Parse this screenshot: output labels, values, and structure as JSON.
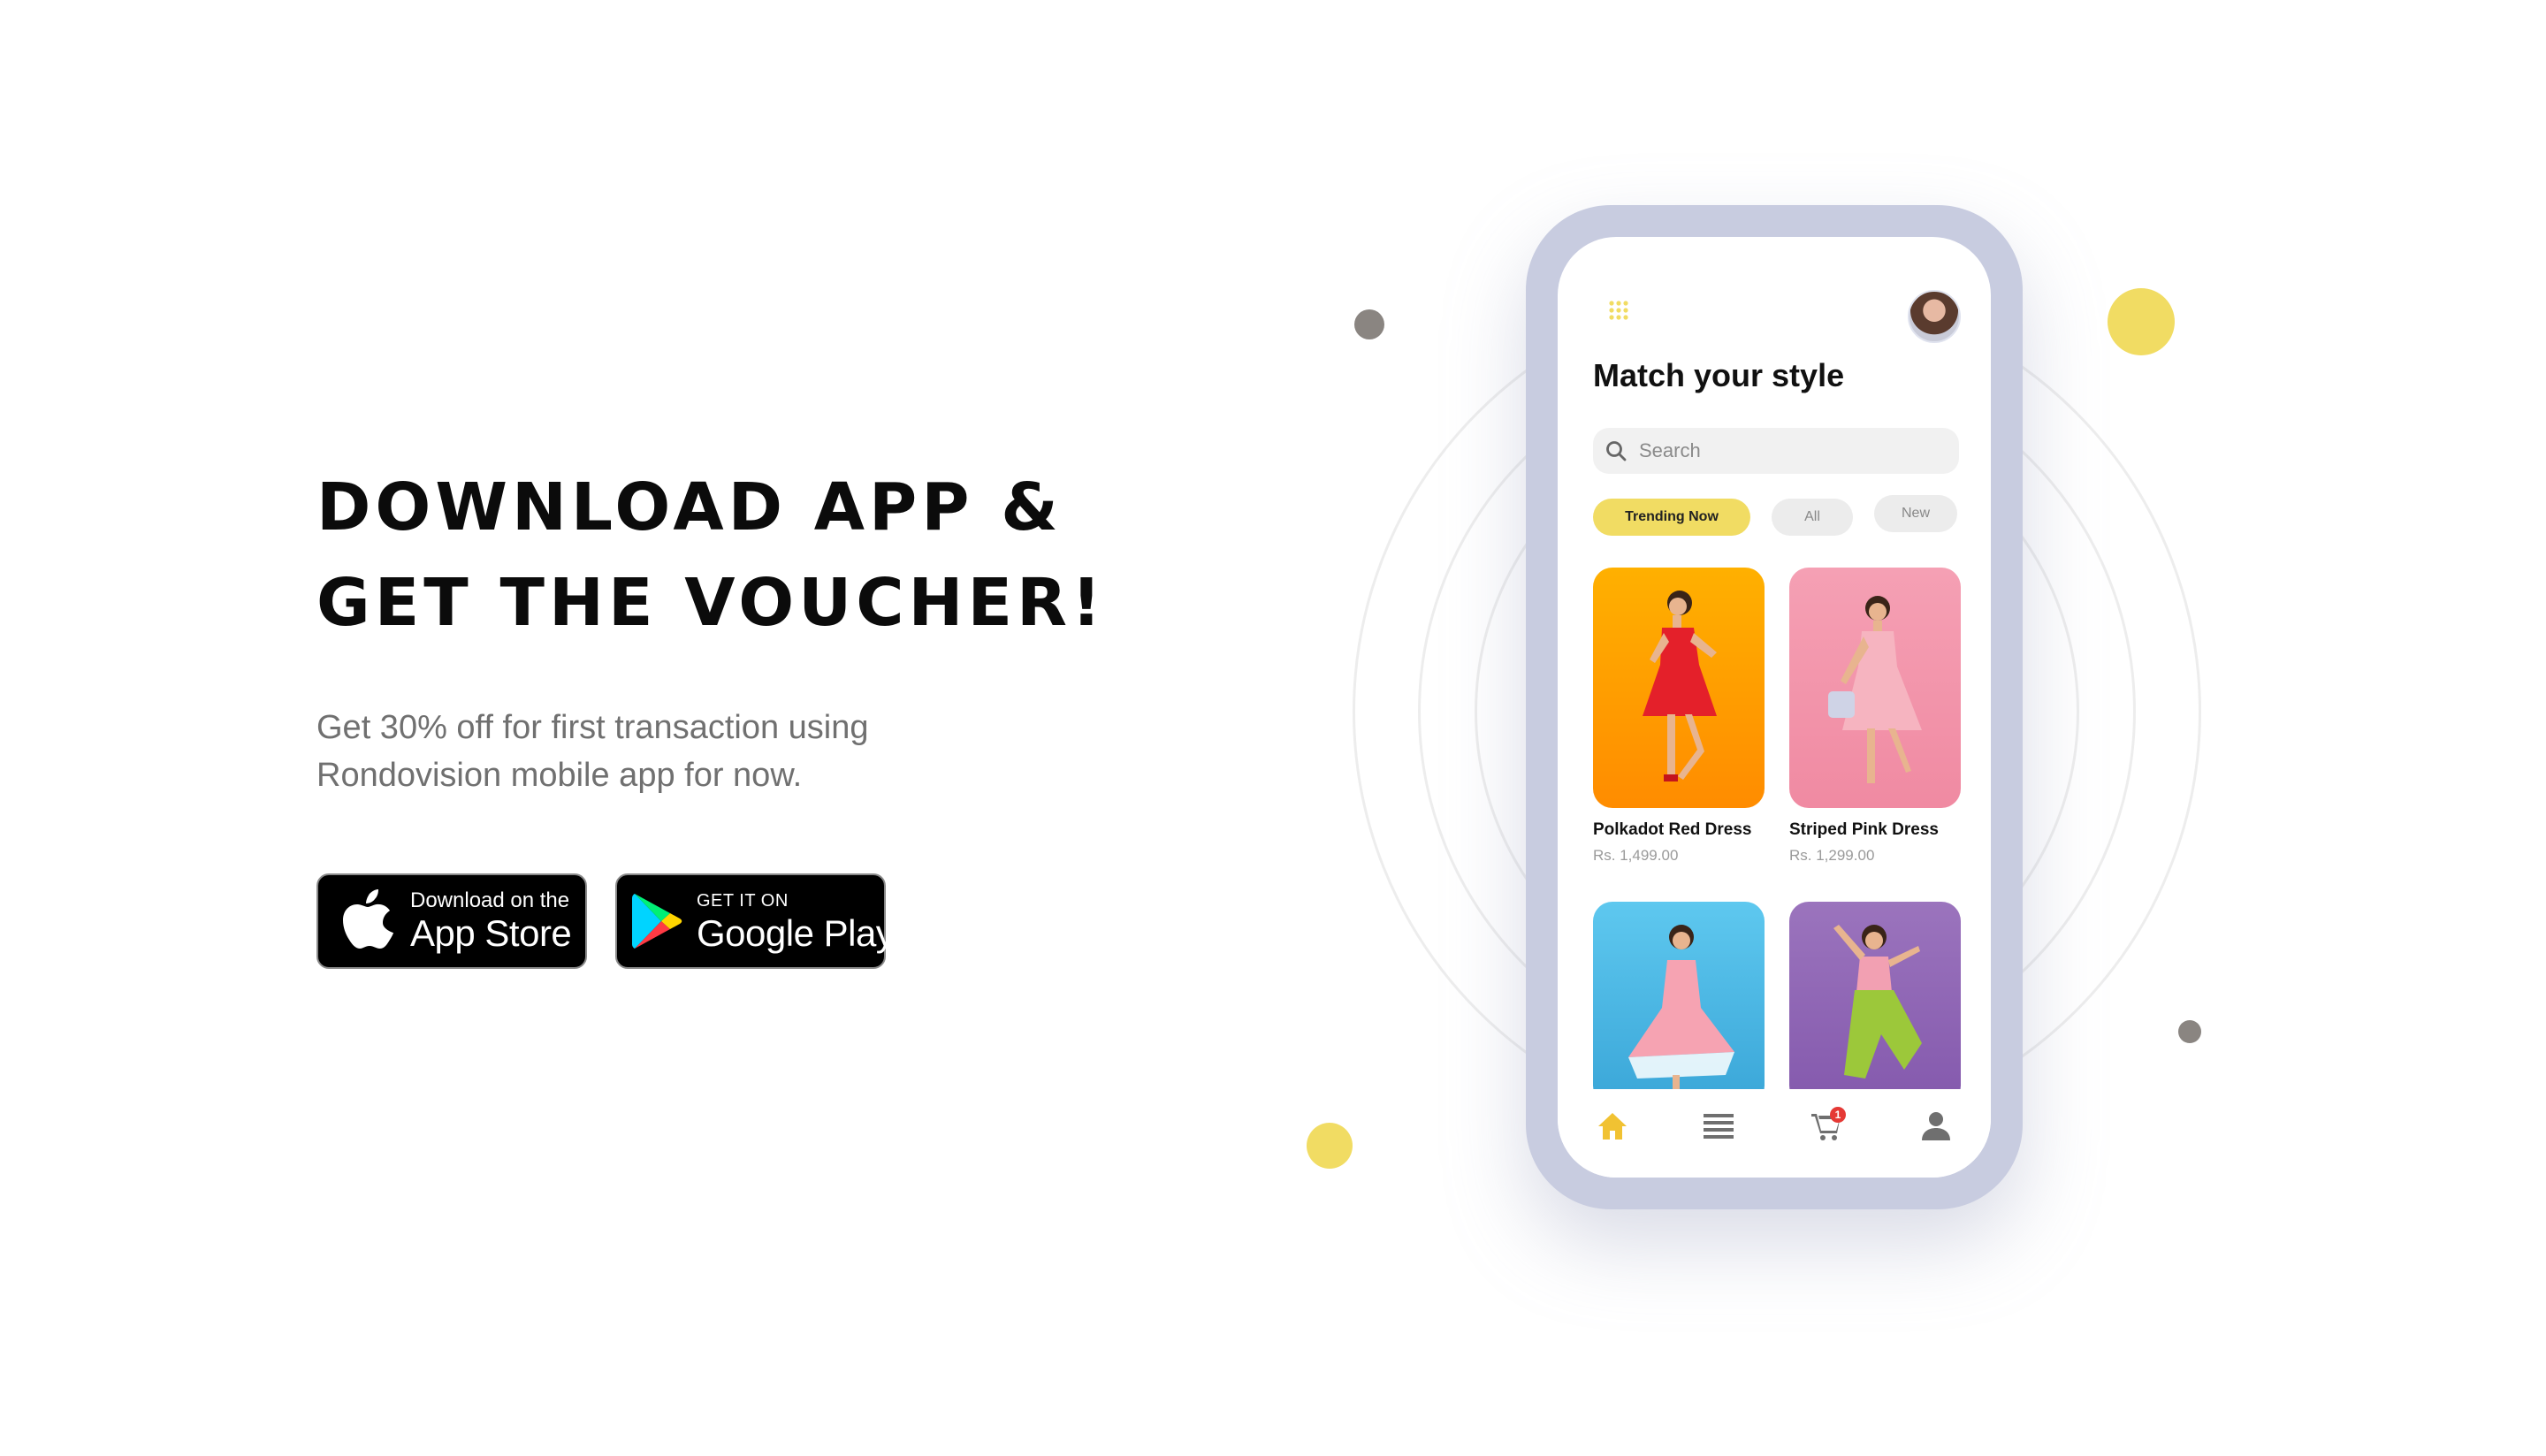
{
  "promo": {
    "headline_line1": "DOWNLOAD APP &",
    "headline_line2": "GET THE VOUCHER!",
    "subtext_line1": "Get 30% off for first transaction using",
    "subtext_line2": "Rondovision mobile app for now."
  },
  "store_buttons": {
    "app_store": {
      "small": "Download on the",
      "big": "App Store",
      "icon": "apple-icon"
    },
    "google_play": {
      "small": "GET IT ON",
      "big": "Google Play",
      "icon": "google-play-icon"
    }
  },
  "colors": {
    "accent_yellow": "#f1dc63",
    "phone_frame": "#c8cce0",
    "dot_gray": "#8a8581",
    "badge_red": "#e53935"
  },
  "app": {
    "title_prefix": "Match your ",
    "title_highlight": "style",
    "search_placeholder": "Search",
    "filters": [
      "Trending Now",
      "All",
      "New"
    ],
    "active_filter": "Trending Now",
    "products": [
      {
        "name": "Polkadot Red Dress",
        "price": "Rs.  1,499.00"
      },
      {
        "name": "Striped Pink Dress",
        "price": "Rs.  1,299.00"
      }
    ],
    "nav": [
      "home-icon",
      "menu-icon",
      "cart-icon",
      "profile-icon"
    ],
    "cart_badge": "1"
  }
}
